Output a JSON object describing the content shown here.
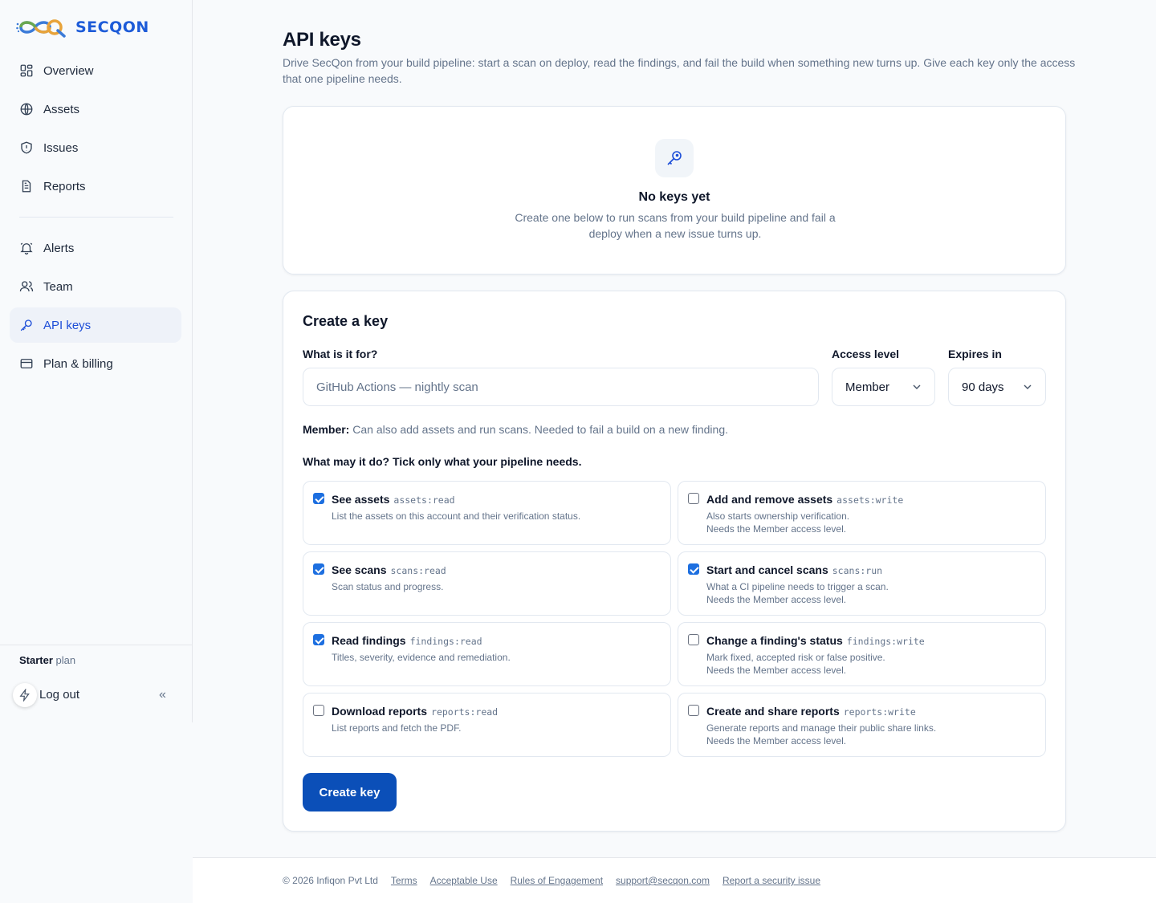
{
  "brand": {
    "name": "SECQON"
  },
  "sidebar": {
    "primary": [
      {
        "label": "Overview",
        "icon": "grid-icon"
      },
      {
        "label": "Assets",
        "icon": "globe-icon"
      },
      {
        "label": "Issues",
        "icon": "shield-icon"
      },
      {
        "label": "Reports",
        "icon": "document-icon"
      }
    ],
    "secondary": [
      {
        "label": "Alerts",
        "icon": "bell-icon"
      },
      {
        "label": "Team",
        "icon": "users-icon"
      },
      {
        "label": "API keys",
        "icon": "key-icon",
        "active": true
      },
      {
        "label": "Plan & billing",
        "icon": "credit-card-icon"
      }
    ],
    "plan_name": "Starter",
    "plan_suffix": "plan",
    "logout_label": "Log out",
    "collapse_glyph": "«"
  },
  "page": {
    "title": "API keys",
    "lead": "Drive SecQon from your build pipeline: start a scan on deploy, read the findings, and fail the build when something new turns up. Give each key only the access that one pipeline needs."
  },
  "empty_state": {
    "title": "No keys yet",
    "text": "Create one below to run scans from your build pipeline and fail a deploy when a new issue turns up."
  },
  "create": {
    "title": "Create a key",
    "purpose_label": "What is it for?",
    "purpose_placeholder": "GitHub Actions — nightly scan",
    "access_label": "Access level",
    "access_value": "Member",
    "expires_label": "Expires in",
    "expires_value": "90 days",
    "member_note_strong": "Member:",
    "member_note_text": "Can also add assets and run scans. Needed to fail a build on a new finding.",
    "permissions_label": "What may it do? Tick only what your pipeline needs.",
    "submit_label": "Create key"
  },
  "permissions": [
    {
      "title": "See assets",
      "scope": "assets:read",
      "desc": "List the assets on this account and their verification status.",
      "note": "",
      "checked": true
    },
    {
      "title": "Add and remove assets",
      "scope": "assets:write",
      "desc": "Also starts ownership verification.",
      "note": "Needs the Member access level.",
      "checked": false
    },
    {
      "title": "See scans",
      "scope": "scans:read",
      "desc": "Scan status and progress.",
      "note": "",
      "checked": true
    },
    {
      "title": "Start and cancel scans",
      "scope": "scans:run",
      "desc": "What a CI pipeline needs to trigger a scan.",
      "note": "Needs the Member access level.",
      "checked": true
    },
    {
      "title": "Read findings",
      "scope": "findings:read",
      "desc": "Titles, severity, evidence and remediation.",
      "note": "",
      "checked": true
    },
    {
      "title": "Change a finding's status",
      "scope": "findings:write",
      "desc": "Mark fixed, accepted risk or false positive.",
      "note": "Needs the Member access level.",
      "checked": false
    },
    {
      "title": "Download reports",
      "scope": "reports:read",
      "desc": "List reports and fetch the PDF.",
      "note": "",
      "checked": false
    },
    {
      "title": "Create and share reports",
      "scope": "reports:write",
      "desc": "Generate reports and manage their public share links.",
      "note": "Needs the Member access level.",
      "checked": false
    }
  ],
  "footer": {
    "copyright": "© 2026 Infiqon Pvt Ltd",
    "links": [
      "Terms",
      "Acceptable Use",
      "Rules of Engagement",
      "support@secqon.com",
      "Report a security issue"
    ]
  },
  "colors": {
    "accent": "#1d4ed8",
    "button": "#0b4fb8",
    "checkbox": "#1d6fe0"
  }
}
